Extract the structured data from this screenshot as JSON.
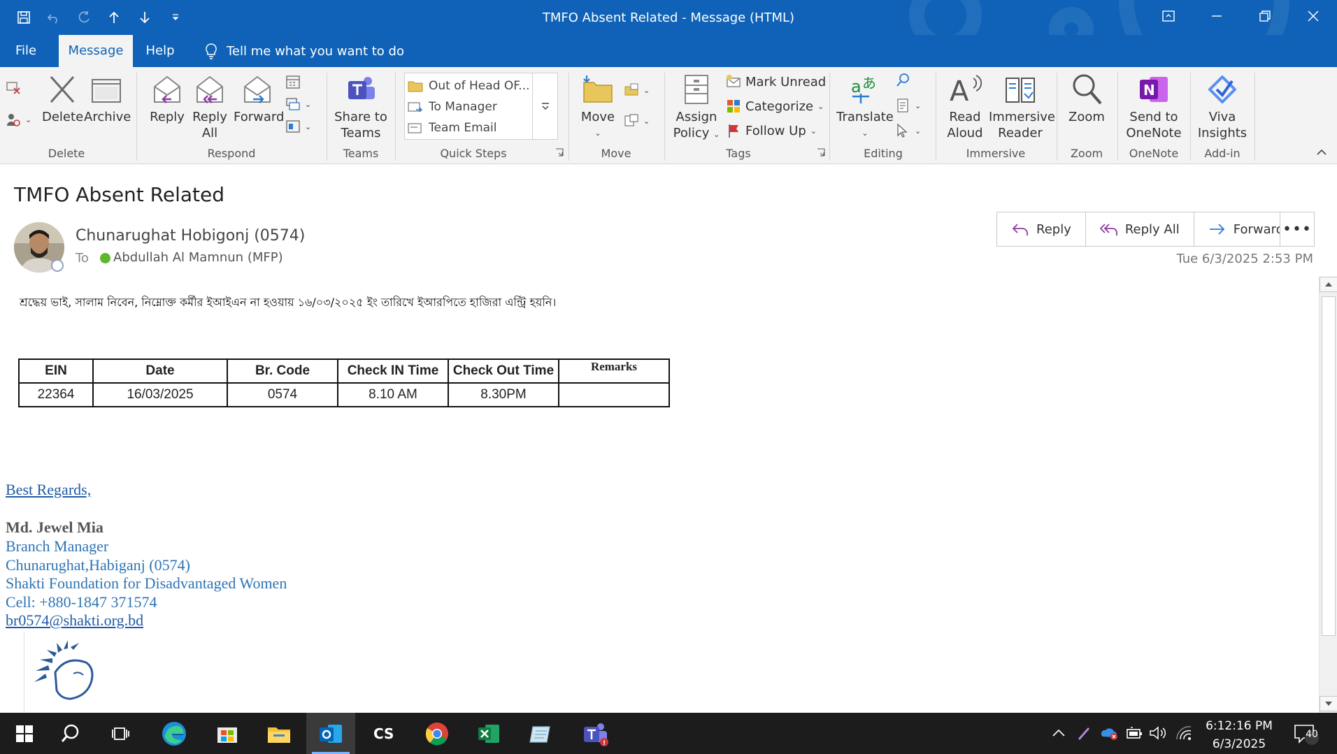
{
  "window": {
    "title": "TMFO Absent Related  -  Message (HTML)"
  },
  "menu": {
    "tabs": [
      "File",
      "Message",
      "Help"
    ],
    "tell_me": "Tell me what you want to do"
  },
  "ribbon": {
    "groups": {
      "delete": "Delete",
      "respond": "Respond",
      "teams": "Teams",
      "quick_steps": "Quick Steps",
      "move": "Move",
      "tags": "Tags",
      "editing": "Editing",
      "immersive": "Immersive",
      "zoom": "Zoom",
      "onenote": "OneNote",
      "addin": "Add-in"
    },
    "buttons": {
      "delete": "Delete",
      "archive": "Archive",
      "reply": "Reply",
      "reply_all_1": "Reply",
      "reply_all_2": "All",
      "forward": "Forward",
      "share_teams_1": "Share to",
      "share_teams_2": "Teams",
      "move": "Move",
      "assign_policy_1": "Assign",
      "assign_policy_2": "Policy",
      "mark_unread": "Mark Unread",
      "categorize": "Categorize",
      "follow_up": "Follow Up",
      "translate": "Translate",
      "read_aloud_1": "Read",
      "read_aloud_2": "Aloud",
      "immersive_reader_1": "Immersive",
      "immersive_reader_2": "Reader",
      "zoom": "Zoom",
      "onenote_1": "Send to",
      "onenote_2": "OneNote",
      "viva_1": "Viva",
      "viva_2": "Insights"
    },
    "quick_steps": [
      "Out of Head OF...",
      "To Manager",
      "Team Email"
    ]
  },
  "message": {
    "subject": "TMFO Absent Related",
    "sender": "Chunarughat Hobigonj (0574)",
    "to_label": "To",
    "recipient": "Abdullah Al Mamnun (MFP)",
    "datetime": "Tue 6/3/2025 2:53 PM",
    "actions": {
      "reply": "Reply",
      "reply_all": "Reply All",
      "forward": "Forward",
      "more": "•••"
    },
    "body_text": "শ্রদ্ধেয় ভাই, সালাম নিবেন, নিম্নোক্ত কর্মীর ইআইএন না হওয়ায় ১৬/০৩/২০২৫ ইং তারিখে ইআরপিতে হাজিরা এন্ট্রি হয়নি।",
    "table": {
      "headers": [
        "EIN",
        "Date",
        "Br. Code",
        "Check IN Time",
        "Check Out Time",
        "Remarks"
      ],
      "rows": [
        [
          "22364",
          "16/03/2025",
          "0574",
          "8.10 AM",
          "8.30PM",
          ""
        ]
      ]
    },
    "signature": {
      "regards": "Best Regards,",
      "name": "Md. Jewel Mia",
      "title": "Branch Manager",
      "branch": "Chunarughat,Habiganj (0574)",
      "org": "Shakti Foundation for Disadvantaged Women",
      "cell": "Cell: +880-1847 371574",
      "email": "br0574@shakti.org.bd"
    }
  },
  "taskbar": {
    "time": "6:12:16 PM",
    "date": "6/3/2025",
    "notifications": "40",
    "apps": [
      "start-icon",
      "search-icon",
      "task-view-icon",
      "edge-icon",
      "store-icon",
      "file-explorer-icon",
      "outlook-icon",
      "cs-app-icon",
      "chrome-icon",
      "excel-icon",
      "notepad-icon",
      "teams-icon"
    ]
  },
  "colors": {
    "titlebar": "#0f62b7",
    "ribbon_bg": "#f3f3f3",
    "signature_blue": "#2e74b5",
    "taskbar": "#1c1c1c"
  }
}
